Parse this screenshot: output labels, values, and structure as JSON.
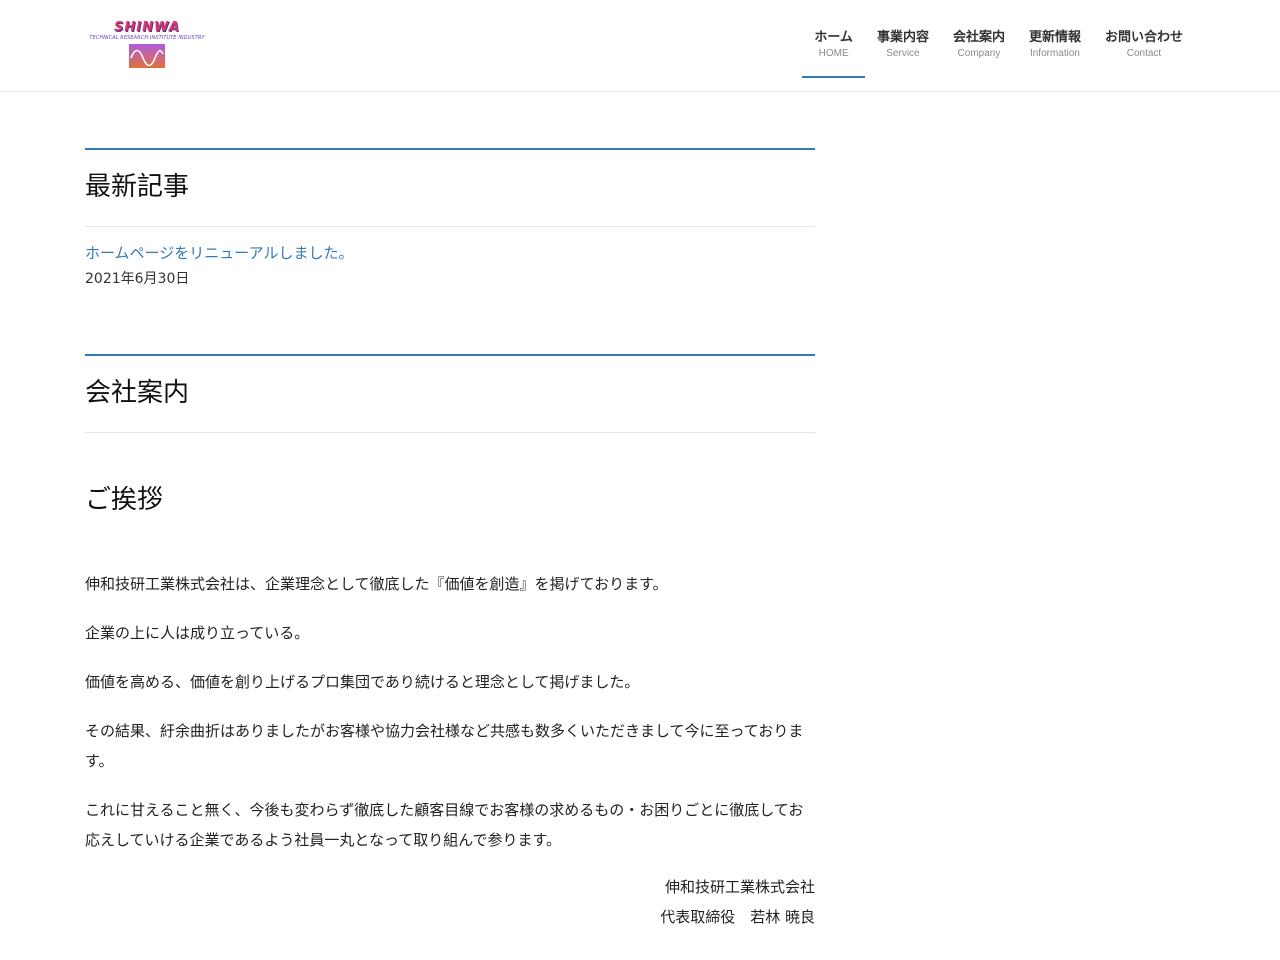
{
  "header": {
    "logo": {
      "wordmark": "SHINWA",
      "tagline": "TECHNICAL RESEARCH INSTITUTE INDUSTRY",
      "colors": {
        "primary": "#d63a6b",
        "secondary": "#6a3fc0"
      }
    },
    "nav": [
      {
        "label": "ホーム",
        "sublabel": "HOME",
        "active": true
      },
      {
        "label": "事業内容",
        "sublabel": "Service",
        "active": false
      },
      {
        "label": "会社案内",
        "sublabel": "Company",
        "active": false
      },
      {
        "label": "更新情報",
        "sublabel": "Information",
        "active": false
      },
      {
        "label": "お問い合わせ",
        "sublabel": "Contact",
        "active": false
      }
    ]
  },
  "latest": {
    "title": "最新記事",
    "items": [
      {
        "title": "ホームページをリニューアルしました。",
        "date": "2021年6月30日"
      }
    ]
  },
  "company": {
    "title": "会社案内",
    "greeting_title": "ご挨拶",
    "paragraphs": [
      "伸和技研工業株式会社は、企業理念として徹底した『価値を創造』を掲げております。",
      "企業の上に人は成り立っている。",
      "価値を高める、価値を創り上げるプロ集団であり続けると理念として掲げました。",
      "その結果、紆余曲折はありましたがお客様や協力会社様など共感も数多くいただきまして今に至っております。",
      "これに甘えること無く、今後も変わらず徹底した顧客目線でお客様の求めるもの・お困りごとに徹底してお応えしていける企業であるよう社員一丸となって取り組んで参ります。"
    ],
    "signature": {
      "company": "伸和技研工業株式会社",
      "person": "代表取締役　若林 暁良"
    }
  },
  "theme": {
    "accent": "#337ab7",
    "text": "#222222",
    "muted": "#8a8a8a",
    "border": "#e6e6e6"
  }
}
